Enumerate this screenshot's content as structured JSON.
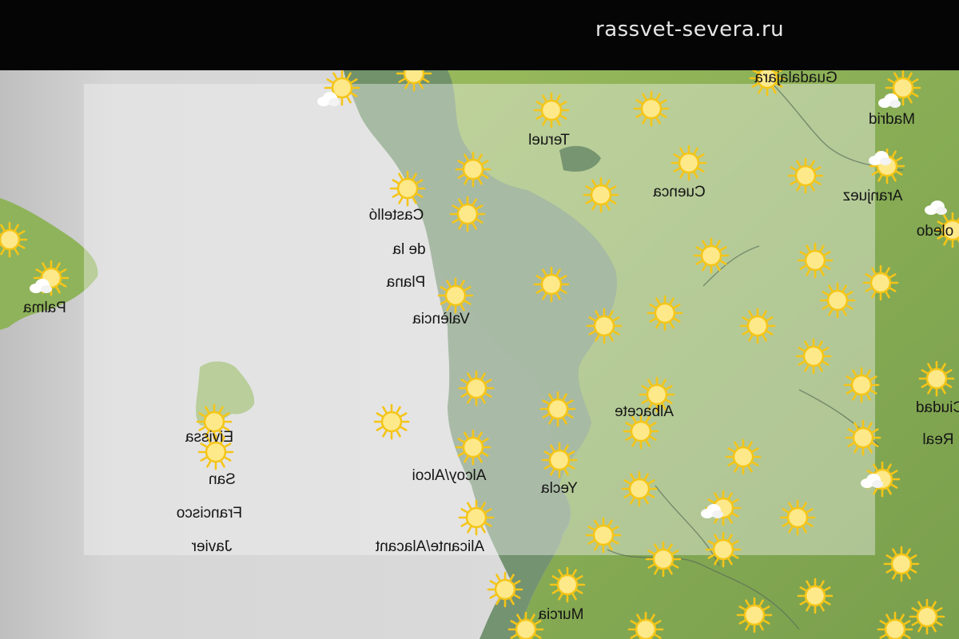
{
  "watermark": "rassvet-severa.ru",
  "map": {
    "cities": [
      {
        "name": "Guadalajara",
        "lines": [
          "Guadalajara"
        ]
      },
      {
        "name": "Teruel",
        "lines": [
          "Teruel"
        ]
      },
      {
        "name": "Madrid",
        "lines": [
          "Madrid"
        ]
      },
      {
        "name": "Cuenca",
        "lines": [
          "Cuenca"
        ]
      },
      {
        "name": "Aranjuez",
        "lines": [
          "Aranjuez"
        ]
      },
      {
        "name": "Toledo",
        "lines": [
          "oledo"
        ]
      },
      {
        "name": "Castello de la Plana",
        "lines": [
          "Castelló",
          "de la",
          "Plana"
        ]
      },
      {
        "name": "Palma",
        "lines": [
          "Palma"
        ]
      },
      {
        "name": "Valencia",
        "lines": [
          "València"
        ]
      },
      {
        "name": "Albacete",
        "lines": [
          "Albacete"
        ]
      },
      {
        "name": "Ciudad Real",
        "lines": [
          "Ciudad",
          "Real"
        ]
      },
      {
        "name": "Eivissa",
        "lines": [
          "Eivissa"
        ]
      },
      {
        "name": "San Francisco Javier",
        "lines": [
          "San",
          "Francisco",
          "Javier"
        ]
      },
      {
        "name": "Alcoy",
        "lines": [
          "Alcoy/Alcoi"
        ]
      },
      {
        "name": "Yecla",
        "lines": [
          "Yecla"
        ]
      },
      {
        "name": "Alicante",
        "lines": [
          "Alicante/Alacant"
        ]
      },
      {
        "name": "Murcia",
        "lines": [
          "Murcia"
        ]
      }
    ],
    "weather_icons": {
      "sun_icon_count": 60,
      "partly_cloudy_icon_count": 7,
      "sun_color": "#f5c518",
      "sun_core_color": "#fde98a"
    },
    "colors": {
      "land": "#8bb154",
      "coastal_lowland": "#6f8f6b",
      "sea": "#dcdcdc",
      "overlay": "#f0f0f0",
      "text": "#151515"
    }
  }
}
